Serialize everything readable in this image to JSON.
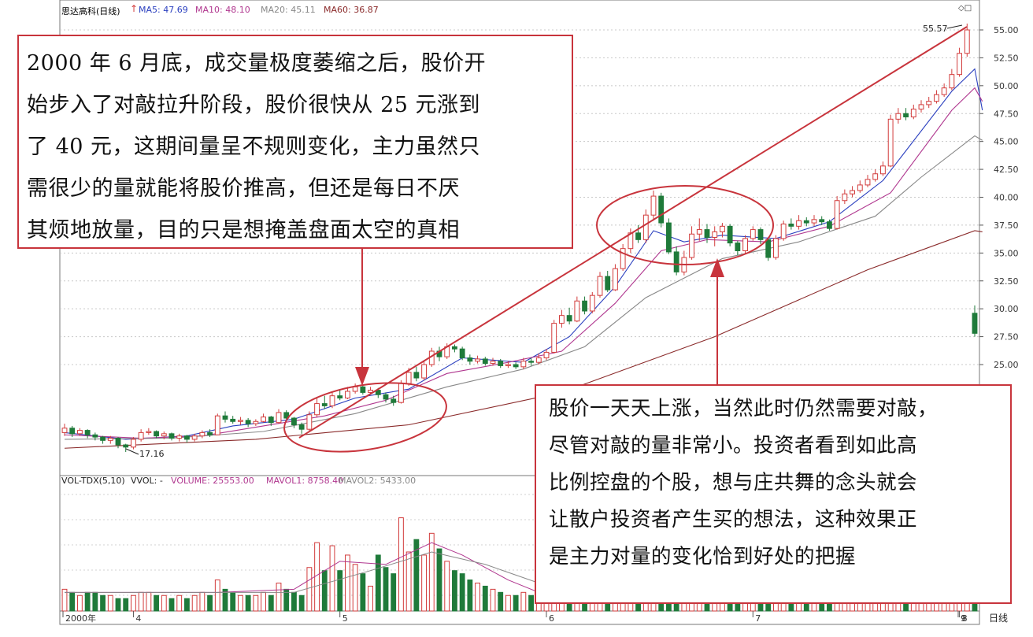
{
  "header": {
    "stock": "思达高科(日线)",
    "ma5": "MA5: 47.69",
    "ma10": "MA10: 48.10",
    "ma20": "MA20: 45.11",
    "ma60": "MA60: 36.87",
    "colors": {
      "ma5": "#2a3fbf",
      "ma10": "#b0378f",
      "ma20": "#888888",
      "ma60": "#8a2a2a"
    }
  },
  "volume_header": {
    "name": "VOL-TDX(5,10)",
    "vvol": "VVOL: -",
    "volume": "VOLUME: 25553.00",
    "mavol1": "MAVOL1: 8758.40",
    "mavol2": "MAVOL2: 5433.00"
  },
  "callouts": {
    "left": [
      "2000 年 6 月底，成交量极度萎缩之后，股价开",
      "始步入了对敲拉升阶段，股价很快从 25 元涨到",
      "了 40 元，这期间量呈不规则变化，主力虽然只",
      "需很少的量就能将股价推高，但还是每日不厌",
      "其烦地放量，目的只是想掩盖盘面太空的真相"
    ],
    "right": [
      "股价一天天上涨，当然此时仍然需要对敲，",
      "尽管对敲的量非常小。投资者看到如此高",
      "比例控盘的个股，想与庄共舞的念头就会",
      "让散户投资者产生买的想法，这种效果正",
      "是主力对量的变化恰到好处的把握"
    ]
  },
  "chart_data": {
    "type": "candlestick",
    "y_axis_ticks": [
      "55.00",
      "52.50",
      "50.00",
      "47.50",
      "45.00",
      "42.50",
      "40.00",
      "37.50",
      "35.00",
      "32.50",
      "30.00",
      "27.50",
      "25.00"
    ],
    "ylim": [
      15.5,
      56.5
    ],
    "x_axis_labels": [
      "2000年",
      "4",
      "5",
      "6",
      "7",
      "8",
      "9"
    ],
    "period_label": "日线",
    "annotations": {
      "high": "55.57",
      "low": "17.16"
    },
    "up_color": "#d23c3c",
    "down_color": "#1f7a3a",
    "candles": [
      {
        "o": 18.9,
        "c": 19.3,
        "h": 19.7,
        "l": 18.6
      },
      {
        "o": 19.3,
        "c": 18.8,
        "h": 19.5,
        "l": 18.5
      },
      {
        "o": 18.8,
        "c": 19.1,
        "h": 19.3,
        "l": 18.6
      },
      {
        "o": 19.1,
        "c": 18.7,
        "h": 19.2,
        "l": 18.4
      },
      {
        "o": 18.7,
        "c": 18.5,
        "h": 18.9,
        "l": 18.2
      },
      {
        "o": 18.5,
        "c": 18.2,
        "h": 18.6,
        "l": 17.9
      },
      {
        "o": 18.2,
        "c": 18.4,
        "h": 18.6,
        "l": 17.9
      },
      {
        "o": 18.4,
        "c": 17.8,
        "h": 18.5,
        "l": 17.5
      },
      {
        "o": 17.8,
        "c": 17.6,
        "h": 17.9,
        "l": 17.16
      },
      {
        "o": 17.6,
        "c": 18.3,
        "h": 18.5,
        "l": 17.4
      },
      {
        "o": 18.3,
        "c": 18.9,
        "h": 19.2,
        "l": 18.1
      },
      {
        "o": 18.9,
        "c": 19.0,
        "h": 19.3,
        "l": 18.7
      },
      {
        "o": 19.0,
        "c": 18.6,
        "h": 19.1,
        "l": 18.4
      },
      {
        "o": 18.6,
        "c": 18.8,
        "h": 19.0,
        "l": 18.3
      },
      {
        "o": 18.8,
        "c": 18.4,
        "h": 18.9,
        "l": 18.2
      },
      {
        "o": 18.4,
        "c": 18.6,
        "h": 18.8,
        "l": 18.1
      },
      {
        "o": 18.6,
        "c": 18.3,
        "h": 18.7,
        "l": 18.0
      },
      {
        "o": 18.3,
        "c": 18.6,
        "h": 18.8,
        "l": 18.1
      },
      {
        "o": 18.6,
        "c": 18.9,
        "h": 19.1,
        "l": 18.4
      },
      {
        "o": 18.9,
        "c": 18.7,
        "h": 19.2,
        "l": 18.5
      },
      {
        "o": 18.7,
        "c": 20.4,
        "h": 20.6,
        "l": 18.7
      },
      {
        "o": 20.4,
        "c": 20.1,
        "h": 20.8,
        "l": 19.8
      },
      {
        "o": 20.1,
        "c": 19.9,
        "h": 20.4,
        "l": 19.7
      },
      {
        "o": 19.9,
        "c": 20.0,
        "h": 20.3,
        "l": 19.6
      },
      {
        "o": 20.0,
        "c": 19.7,
        "h": 20.2,
        "l": 19.4
      },
      {
        "o": 19.7,
        "c": 19.9,
        "h": 20.1,
        "l": 19.5
      },
      {
        "o": 19.9,
        "c": 20.3,
        "h": 20.6,
        "l": 19.8
      },
      {
        "o": 20.3,
        "c": 19.8,
        "h": 20.4,
        "l": 19.5
      },
      {
        "o": 19.8,
        "c": 20.7,
        "h": 21.0,
        "l": 19.7
      },
      {
        "o": 20.7,
        "c": 20.2,
        "h": 20.9,
        "l": 19.9
      },
      {
        "o": 20.2,
        "c": 19.6,
        "h": 20.3,
        "l": 19.3
      },
      {
        "o": 19.6,
        "c": 19.2,
        "h": 19.8,
        "l": 18.8
      },
      {
        "o": 19.2,
        "c": 20.5,
        "h": 20.8,
        "l": 19.0
      },
      {
        "o": 20.5,
        "c": 21.5,
        "h": 22.0,
        "l": 20.3
      },
      {
        "o": 21.5,
        "c": 21.3,
        "h": 22.2,
        "l": 21.0
      },
      {
        "o": 21.3,
        "c": 22.2,
        "h": 22.6,
        "l": 21.1
      },
      {
        "o": 22.2,
        "c": 22.0,
        "h": 22.7,
        "l": 21.8
      },
      {
        "o": 22.0,
        "c": 22.6,
        "h": 23.0,
        "l": 21.9
      },
      {
        "o": 22.6,
        "c": 23.0,
        "h": 23.3,
        "l": 22.4
      },
      {
        "o": 23.0,
        "c": 22.5,
        "h": 23.2,
        "l": 22.3
      },
      {
        "o": 22.5,
        "c": 22.7,
        "h": 23.0,
        "l": 22.3
      },
      {
        "o": 22.7,
        "c": 22.3,
        "h": 22.9,
        "l": 22.0
      },
      {
        "o": 22.3,
        "c": 21.9,
        "h": 22.5,
        "l": 21.6
      },
      {
        "o": 21.9,
        "c": 21.6,
        "h": 22.2,
        "l": 21.3
      },
      {
        "o": 21.6,
        "c": 23.3,
        "h": 23.6,
        "l": 21.5
      },
      {
        "o": 23.3,
        "c": 24.3,
        "h": 24.7,
        "l": 23.1
      },
      {
        "o": 24.3,
        "c": 23.8,
        "h": 24.8,
        "l": 23.5
      },
      {
        "o": 23.8,
        "c": 25.0,
        "h": 25.4,
        "l": 23.6
      },
      {
        "o": 25.0,
        "c": 26.2,
        "h": 26.5,
        "l": 24.8
      },
      {
        "o": 26.2,
        "c": 25.7,
        "h": 26.6,
        "l": 25.3
      },
      {
        "o": 25.7,
        "c": 26.6,
        "h": 26.9,
        "l": 25.5
      },
      {
        "o": 26.6,
        "c": 26.4,
        "h": 26.8,
        "l": 26.1
      },
      {
        "o": 26.4,
        "c": 25.6,
        "h": 26.6,
        "l": 25.4
      },
      {
        "o": 25.6,
        "c": 25.3,
        "h": 25.9,
        "l": 25.0
      },
      {
        "o": 25.3,
        "c": 25.5,
        "h": 25.8,
        "l": 25.1
      },
      {
        "o": 25.5,
        "c": 25.1,
        "h": 25.7,
        "l": 24.9
      },
      {
        "o": 25.1,
        "c": 25.3,
        "h": 25.6,
        "l": 24.9
      },
      {
        "o": 25.3,
        "c": 24.9,
        "h": 25.5,
        "l": 24.7
      },
      {
        "o": 24.9,
        "c": 25.0,
        "h": 25.3,
        "l": 24.7
      },
      {
        "o": 25.0,
        "c": 24.8,
        "h": 25.2,
        "l": 24.6
      },
      {
        "o": 24.8,
        "c": 25.3,
        "h": 25.6,
        "l": 24.6
      },
      {
        "o": 25.3,
        "c": 25.2,
        "h": 25.6,
        "l": 24.9
      },
      {
        "o": 25.2,
        "c": 25.6,
        "h": 26.0,
        "l": 25.0
      },
      {
        "o": 25.6,
        "c": 26.1,
        "h": 26.4,
        "l": 25.4
      },
      {
        "o": 26.1,
        "c": 28.7,
        "h": 29.0,
        "l": 26.0
      },
      {
        "o": 28.7,
        "c": 29.4,
        "h": 29.9,
        "l": 28.3
      },
      {
        "o": 29.4,
        "c": 28.9,
        "h": 30.1,
        "l": 28.6
      },
      {
        "o": 28.9,
        "c": 30.7,
        "h": 31.1,
        "l": 28.8
      },
      {
        "o": 30.7,
        "c": 29.8,
        "h": 31.1,
        "l": 29.5
      },
      {
        "o": 29.8,
        "c": 31.2,
        "h": 31.5,
        "l": 29.6
      },
      {
        "o": 31.2,
        "c": 32.9,
        "h": 33.3,
        "l": 31.0
      },
      {
        "o": 32.9,
        "c": 31.7,
        "h": 33.4,
        "l": 31.5
      },
      {
        "o": 31.7,
        "c": 33.6,
        "h": 34.0,
        "l": 31.6
      },
      {
        "o": 33.6,
        "c": 35.4,
        "h": 35.8,
        "l": 33.4
      },
      {
        "o": 35.4,
        "c": 36.8,
        "h": 37.2,
        "l": 35.0
      },
      {
        "o": 36.8,
        "c": 36.2,
        "h": 37.5,
        "l": 35.9
      },
      {
        "o": 36.2,
        "c": 38.4,
        "h": 38.9,
        "l": 35.9
      },
      {
        "o": 38.4,
        "c": 40.1,
        "h": 40.6,
        "l": 37.9
      },
      {
        "o": 40.1,
        "c": 37.7,
        "h": 40.4,
        "l": 37.3
      },
      {
        "o": 37.7,
        "c": 35.1,
        "h": 38.1,
        "l": 34.9
      },
      {
        "o": 35.1,
        "c": 33.3,
        "h": 35.6,
        "l": 33.0
      },
      {
        "o": 33.3,
        "c": 34.6,
        "h": 35.2,
        "l": 33.0
      },
      {
        "o": 34.6,
        "c": 36.7,
        "h": 37.4,
        "l": 34.4
      },
      {
        "o": 36.7,
        "c": 37.1,
        "h": 38.1,
        "l": 36.1
      },
      {
        "o": 37.1,
        "c": 36.4,
        "h": 37.6,
        "l": 35.9
      },
      {
        "o": 36.4,
        "c": 36.9,
        "h": 37.4,
        "l": 35.6
      },
      {
        "o": 36.9,
        "c": 37.4,
        "h": 37.7,
        "l": 36.4
      },
      {
        "o": 37.4,
        "c": 35.9,
        "h": 37.6,
        "l": 35.6
      },
      {
        "o": 35.9,
        "c": 35.2,
        "h": 36.1,
        "l": 34.8
      },
      {
        "o": 35.2,
        "c": 36.3,
        "h": 36.6,
        "l": 34.9
      },
      {
        "o": 36.3,
        "c": 37.1,
        "h": 37.4,
        "l": 36.1
      },
      {
        "o": 37.1,
        "c": 36.2,
        "h": 37.3,
        "l": 35.8
      },
      {
        "o": 36.2,
        "c": 34.6,
        "h": 36.4,
        "l": 34.3
      },
      {
        "o": 34.6,
        "c": 36.3,
        "h": 36.6,
        "l": 34.4
      },
      {
        "o": 36.3,
        "c": 37.6,
        "h": 37.9,
        "l": 36.1
      },
      {
        "o": 37.6,
        "c": 37.4,
        "h": 38.1,
        "l": 37.1
      },
      {
        "o": 37.4,
        "c": 37.9,
        "h": 38.4,
        "l": 37.1
      },
      {
        "o": 37.9,
        "c": 37.7,
        "h": 38.2,
        "l": 37.4
      },
      {
        "o": 37.7,
        "c": 38.0,
        "h": 38.4,
        "l": 37.4
      },
      {
        "o": 38.0,
        "c": 37.8,
        "h": 38.3,
        "l": 37.5
      },
      {
        "o": 37.8,
        "c": 37.2,
        "h": 38.0,
        "l": 37.0
      },
      {
        "o": 37.2,
        "c": 39.7,
        "h": 40.1,
        "l": 37.1
      },
      {
        "o": 39.7,
        "c": 40.3,
        "h": 40.7,
        "l": 39.4
      },
      {
        "o": 40.3,
        "c": 40.6,
        "h": 41.0,
        "l": 40.0
      },
      {
        "o": 40.6,
        "c": 41.1,
        "h": 41.5,
        "l": 40.4
      },
      {
        "o": 41.1,
        "c": 41.6,
        "h": 42.0,
        "l": 40.9
      },
      {
        "o": 41.6,
        "c": 42.1,
        "h": 42.5,
        "l": 41.4
      },
      {
        "o": 42.1,
        "c": 42.8,
        "h": 43.2,
        "l": 41.9
      },
      {
        "o": 42.8,
        "c": 47.0,
        "h": 47.4,
        "l": 42.7
      },
      {
        "o": 47.0,
        "c": 47.5,
        "h": 48.0,
        "l": 46.6
      },
      {
        "o": 47.5,
        "c": 47.2,
        "h": 48.0,
        "l": 46.9
      },
      {
        "o": 47.2,
        "c": 47.9,
        "h": 48.3,
        "l": 47.0
      },
      {
        "o": 47.9,
        "c": 48.3,
        "h": 48.7,
        "l": 47.6
      },
      {
        "o": 48.3,
        "c": 48.6,
        "h": 49.0,
        "l": 48.0
      },
      {
        "o": 48.6,
        "c": 49.2,
        "h": 49.6,
        "l": 48.4
      },
      {
        "o": 49.2,
        "c": 49.8,
        "h": 50.2,
        "l": 49.0
      },
      {
        "o": 49.8,
        "c": 51.0,
        "h": 51.5,
        "l": 49.6
      },
      {
        "o": 51.0,
        "c": 52.9,
        "h": 53.4,
        "l": 50.8
      },
      {
        "o": 52.9,
        "c": 55.0,
        "h": 55.57,
        "l": 52.6
      },
      {
        "o": 29.6,
        "c": 27.8,
        "h": 30.3,
        "l": 27.5
      }
    ],
    "ma_lines": [
      {
        "name": "MA5",
        "color": "#2a3fbf",
        "values": [
          [
            0,
            18.9
          ],
          [
            8,
            18.3
          ],
          [
            16,
            18.6
          ],
          [
            22,
            19.5
          ],
          [
            30,
            20.1
          ],
          [
            38,
            22.0
          ],
          [
            45,
            22.8
          ],
          [
            52,
            25.6
          ],
          [
            60,
            25.2
          ],
          [
            66,
            27.5
          ],
          [
            72,
            32.0
          ],
          [
            77,
            37.0
          ],
          [
            81,
            36.0
          ],
          [
            86,
            36.6
          ],
          [
            93,
            36.3
          ],
          [
            100,
            37.8
          ],
          [
            107,
            41.5
          ],
          [
            116,
            49.5
          ],
          [
            119,
            51.5
          ],
          [
            120,
            47.8
          ]
        ]
      },
      {
        "name": "MA10",
        "color": "#b0378f",
        "values": [
          [
            0,
            18.7
          ],
          [
            10,
            18.4
          ],
          [
            18,
            18.6
          ],
          [
            26,
            19.5
          ],
          [
            34,
            20.4
          ],
          [
            42,
            21.8
          ],
          [
            50,
            24.2
          ],
          [
            58,
            25.2
          ],
          [
            65,
            26.2
          ],
          [
            72,
            30.5
          ],
          [
            78,
            35.2
          ],
          [
            84,
            36.2
          ],
          [
            92,
            36.0
          ],
          [
            100,
            37.4
          ],
          [
            108,
            40.4
          ],
          [
            116,
            47.8
          ],
          [
            119,
            49.8
          ],
          [
            120,
            48.6
          ]
        ]
      },
      {
        "name": "MA20",
        "color": "#888888",
        "values": [
          [
            0,
            18.3
          ],
          [
            14,
            18.4
          ],
          [
            26,
            19.0
          ],
          [
            38,
            20.6
          ],
          [
            50,
            23.0
          ],
          [
            60,
            24.6
          ],
          [
            68,
            26.6
          ],
          [
            76,
            31.0
          ],
          [
            86,
            34.5
          ],
          [
            96,
            36.0
          ],
          [
            106,
            38.3
          ],
          [
            112,
            41.8
          ],
          [
            119,
            45.5
          ],
          [
            120,
            45.1
          ]
        ]
      },
      {
        "name": "MA60",
        "color": "#8a2a2a",
        "values": [
          [
            0,
            17.5
          ],
          [
            25,
            18.3
          ],
          [
            45,
            19.6
          ],
          [
            65,
            22.5
          ],
          [
            85,
            27.5
          ],
          [
            105,
            33.5
          ],
          [
            119,
            37.0
          ],
          [
            120,
            36.9
          ]
        ]
      }
    ],
    "volume": {
      "values": [
        7,
        6,
        5,
        6,
        6,
        5,
        5,
        4,
        4,
        5,
        6,
        6,
        5,
        5,
        4,
        5,
        4,
        5,
        6,
        5,
        10,
        7,
        6,
        5,
        5,
        5,
        6,
        5,
        9,
        7,
        6,
        5,
        14,
        22,
        13,
        21,
        13,
        18,
        15,
        12,
        8,
        18,
        14,
        12,
        30,
        19,
        23,
        18,
        25,
        20,
        16,
        13,
        12,
        10,
        9,
        8,
        7,
        6,
        5,
        5,
        6,
        5,
        6,
        7,
        17,
        14,
        10,
        22,
        12,
        15,
        19,
        12,
        16,
        22,
        25,
        14,
        24,
        27,
        20,
        19,
        14,
        12,
        14,
        16,
        15,
        12,
        11,
        12,
        14,
        13,
        11,
        10,
        13,
        14,
        12,
        13,
        11,
        12,
        11,
        10,
        18,
        15,
        12,
        13,
        13,
        12,
        14,
        22,
        18,
        14,
        15,
        16,
        15,
        17,
        18,
        24,
        30,
        34,
        38,
        22
      ],
      "mavol_lines": [
        {
          "name": "MAVOL1",
          "color": "#b0378f",
          "values": [
            [
              0,
              6
            ],
            [
              20,
              6
            ],
            [
              30,
              7
            ],
            [
              36,
              16
            ],
            [
              42,
              15
            ],
            [
              48,
              22
            ],
            [
              52,
              18
            ],
            [
              58,
              10
            ],
            [
              62,
              6
            ],
            [
              66,
              10
            ],
            [
              72,
              16
            ],
            [
              78,
              22
            ],
            [
              84,
              18
            ],
            [
              92,
              13
            ],
            [
              100,
              14
            ],
            [
              110,
              16
            ],
            [
              120,
              28
            ]
          ]
        },
        {
          "name": "MAVOL2",
          "color": "#888888",
          "values": [
            [
              0,
              6
            ],
            [
              30,
              6
            ],
            [
              40,
              13
            ],
            [
              48,
              19
            ],
            [
              55,
              15
            ],
            [
              62,
              9
            ],
            [
              70,
              12
            ],
            [
              80,
              19
            ],
            [
              90,
              15
            ],
            [
              100,
              13
            ],
            [
              110,
              15
            ],
            [
              120,
              22
            ]
          ]
        }
      ]
    }
  }
}
